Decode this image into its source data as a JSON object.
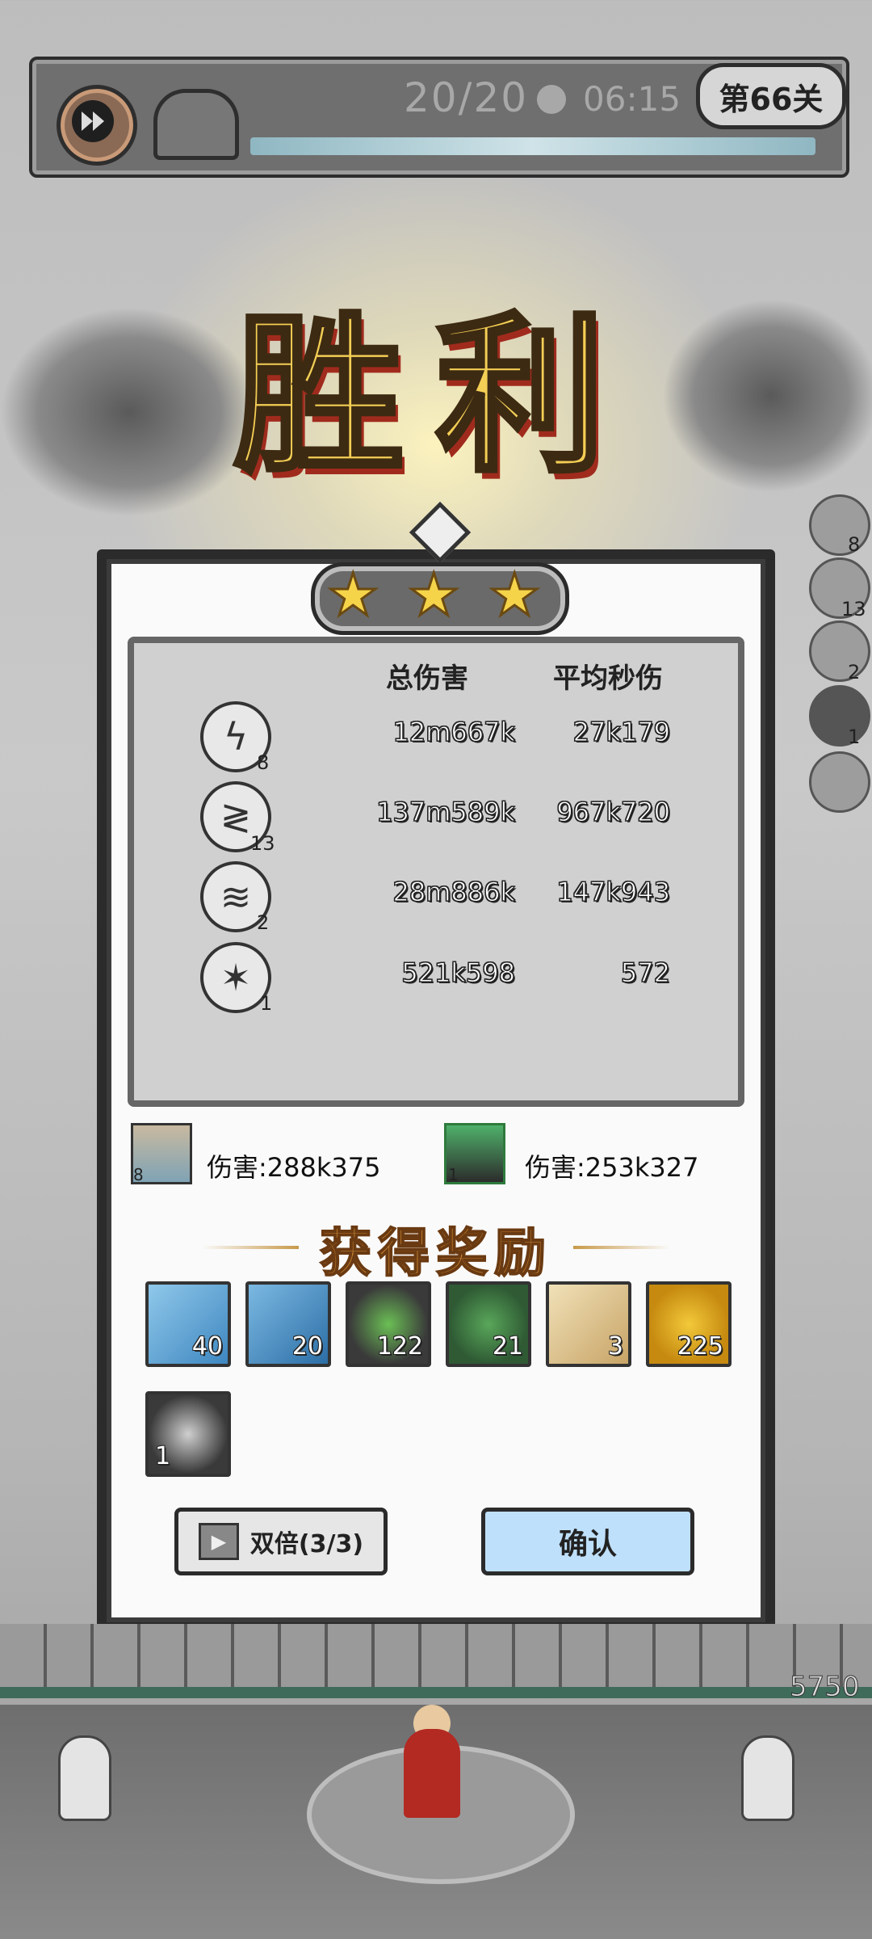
{
  "hud": {
    "wave": "20/20",
    "timer": "06:15",
    "level": "第66关"
  },
  "title": "胜利",
  "stars": 3,
  "stats": {
    "header_total": "总伤害",
    "header_dps": "平均秒伤",
    "rows": [
      {
        "skill_icon": "lightning-strike-icon",
        "level": "8",
        "total": "12m667k",
        "dps": "27k179"
      },
      {
        "skill_icon": "chain-lightning-icon",
        "level": "13",
        "total": "137m589k",
        "dps": "967k720"
      },
      {
        "skill_icon": "tornado-icon",
        "level": "2",
        "total": "28m886k",
        "dps": "147k943"
      },
      {
        "skill_icon": "ice-crystal-icon",
        "level": "1",
        "total": "521k598",
        "dps": "572"
      }
    ]
  },
  "heroes": [
    {
      "avatar": "female-hero-avatar",
      "level": "8",
      "damage": "伤害:288k375"
    },
    {
      "avatar": "male-hero-avatar",
      "level": "1",
      "damage": "伤害:253k327"
    }
  ],
  "rewards_title": "获得奖励",
  "rewards": [
    {
      "icon": "ice-scroll-icon",
      "count": "40"
    },
    {
      "icon": "comet-scroll-icon",
      "count": "20"
    },
    {
      "icon": "green-essence-icon",
      "count": "122"
    },
    {
      "icon": "exp-orb-icon",
      "count": "21"
    },
    {
      "icon": "map-scroll-icon",
      "count": "3"
    },
    {
      "icon": "gold-coin-icon",
      "count": "225"
    },
    {
      "icon": "ore-chunk-icon",
      "count": "1"
    }
  ],
  "buttons": {
    "double": "双倍(3/3)",
    "confirm": "确认"
  },
  "side_levels": [
    "8",
    "13",
    "2",
    "1"
  ],
  "base_hp": "5750",
  "colors": {
    "gold": "#f4cf55",
    "confirm_bg": "#bfe0fb",
    "reward_title": "#d08a32"
  }
}
